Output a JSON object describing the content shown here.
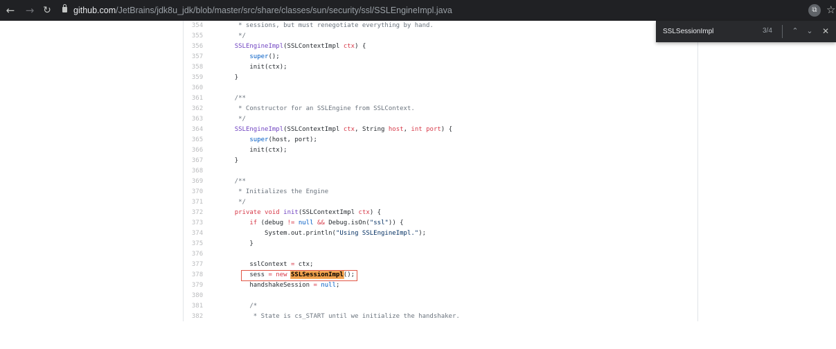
{
  "browser": {
    "url_domain": "github.com",
    "url_path": "/JetBrains/jdk8u_jdk/blob/master/src/share/classes/sun/security/ssl/SSLEngineImpl.java",
    "nav_icons": [
      "back-arrow-icon",
      "forward-arrow-icon",
      "reload-icon"
    ],
    "lock_icon": "lock-icon",
    "extension_icon_glyph": "⧉",
    "bookmark_icon_glyph": "☆"
  },
  "find_bar": {
    "query": "SSLSessionImpl",
    "count": "3/4",
    "icons": {
      "prev": "chevron-up-icon",
      "next": "chevron-down-icon",
      "close": "close-icon"
    }
  },
  "colors": {
    "toolbar_bg": "#202124",
    "keyword": "#d73a49",
    "entity": "#6f42c1",
    "constant": "#005cc5",
    "comment": "#6a737d",
    "search_highlight": "#f0a04b",
    "annotation_box": "#e15544"
  },
  "code": {
    "lines": [
      {
        "n": "354",
        "tokens": [
          {
            "t": "     * sessions, but must renegotiate everything by hand.",
            "c": "cmt"
          }
        ]
      },
      {
        "n": "355",
        "tokens": [
          {
            "t": "     */",
            "c": "cmt"
          }
        ]
      },
      {
        "n": "356",
        "tokens": [
          {
            "t": "    ",
            "c": ""
          },
          {
            "t": "SSLEngineImpl",
            "c": "ent"
          },
          {
            "t": "(SSLContextImpl ",
            "c": ""
          },
          {
            "t": "ctx",
            "c": "kw"
          },
          {
            "t": ") {",
            "c": ""
          }
        ]
      },
      {
        "n": "357",
        "tokens": [
          {
            "t": "        ",
            "c": ""
          },
          {
            "t": "super",
            "c": "sup"
          },
          {
            "t": "();",
            "c": ""
          }
        ]
      },
      {
        "n": "358",
        "tokens": [
          {
            "t": "        init(ctx);",
            "c": ""
          }
        ]
      },
      {
        "n": "359",
        "tokens": [
          {
            "t": "    }",
            "c": ""
          }
        ]
      },
      {
        "n": "360",
        "tokens": [
          {
            "t": "",
            "c": ""
          }
        ]
      },
      {
        "n": "361",
        "tokens": [
          {
            "t": "    /**",
            "c": "cmt"
          }
        ]
      },
      {
        "n": "362",
        "tokens": [
          {
            "t": "     * Constructor for an SSLEngine from SSLContext.",
            "c": "cmt"
          }
        ]
      },
      {
        "n": "363",
        "tokens": [
          {
            "t": "     */",
            "c": "cmt"
          }
        ]
      },
      {
        "n": "364",
        "tokens": [
          {
            "t": "    ",
            "c": ""
          },
          {
            "t": "SSLEngineImpl",
            "c": "ent"
          },
          {
            "t": "(SSLContextImpl ",
            "c": ""
          },
          {
            "t": "ctx",
            "c": "kw"
          },
          {
            "t": ", String ",
            "c": ""
          },
          {
            "t": "host",
            "c": "kw"
          },
          {
            "t": ", ",
            "c": ""
          },
          {
            "t": "int",
            "c": "kw"
          },
          {
            "t": " ",
            "c": ""
          },
          {
            "t": "port",
            "c": "kw"
          },
          {
            "t": ") {",
            "c": ""
          }
        ]
      },
      {
        "n": "365",
        "tokens": [
          {
            "t": "        ",
            "c": ""
          },
          {
            "t": "super",
            "c": "sup"
          },
          {
            "t": "(host, port);",
            "c": ""
          }
        ]
      },
      {
        "n": "366",
        "tokens": [
          {
            "t": "        init(ctx);",
            "c": ""
          }
        ]
      },
      {
        "n": "367",
        "tokens": [
          {
            "t": "    }",
            "c": ""
          }
        ]
      },
      {
        "n": "368",
        "tokens": [
          {
            "t": "",
            "c": ""
          }
        ]
      },
      {
        "n": "369",
        "tokens": [
          {
            "t": "    /**",
            "c": "cmt"
          }
        ]
      },
      {
        "n": "370",
        "tokens": [
          {
            "t": "     * Initializes the Engine",
            "c": "cmt"
          }
        ]
      },
      {
        "n": "371",
        "tokens": [
          {
            "t": "     */",
            "c": "cmt"
          }
        ]
      },
      {
        "n": "372",
        "tokens": [
          {
            "t": "    ",
            "c": ""
          },
          {
            "t": "private",
            "c": "kw"
          },
          {
            "t": " ",
            "c": ""
          },
          {
            "t": "void",
            "c": "kw"
          },
          {
            "t": " ",
            "c": ""
          },
          {
            "t": "init",
            "c": "ent"
          },
          {
            "t": "(SSLContextImpl ",
            "c": ""
          },
          {
            "t": "ctx",
            "c": "kw"
          },
          {
            "t": ") {",
            "c": ""
          }
        ]
      },
      {
        "n": "373",
        "tokens": [
          {
            "t": "        ",
            "c": ""
          },
          {
            "t": "if",
            "c": "kw"
          },
          {
            "t": " (debug ",
            "c": ""
          },
          {
            "t": "!=",
            "c": "kw"
          },
          {
            "t": " ",
            "c": ""
          },
          {
            "t": "null",
            "c": "sup"
          },
          {
            "t": " ",
            "c": ""
          },
          {
            "t": "&&",
            "c": "kw"
          },
          {
            "t": " Debug.isOn(",
            "c": ""
          },
          {
            "t": "\"ssl\"",
            "c": "str"
          },
          {
            "t": ")) {",
            "c": ""
          }
        ]
      },
      {
        "n": "374",
        "tokens": [
          {
            "t": "            System.out.println(",
            "c": ""
          },
          {
            "t": "\"Using SSLEngineImpl.\"",
            "c": "str"
          },
          {
            "t": ");",
            "c": ""
          }
        ]
      },
      {
        "n": "375",
        "tokens": [
          {
            "t": "        }",
            "c": ""
          }
        ]
      },
      {
        "n": "376",
        "tokens": [
          {
            "t": "",
            "c": ""
          }
        ]
      },
      {
        "n": "377",
        "tokens": [
          {
            "t": "        sslContext ",
            "c": ""
          },
          {
            "t": "=",
            "c": "kw"
          },
          {
            "t": " ctx;",
            "c": ""
          }
        ]
      },
      {
        "n": "378",
        "tokens": [
          {
            "t": "        sess ",
            "c": ""
          },
          {
            "t": "=",
            "c": "kw"
          },
          {
            "t": " ",
            "c": ""
          },
          {
            "t": "new",
            "c": "kw"
          },
          {
            "t": " ",
            "c": ""
          },
          {
            "t": "SSLSessionImpl",
            "c": "hit"
          },
          {
            "t": "();",
            "c": ""
          }
        ]
      },
      {
        "n": "379",
        "tokens": [
          {
            "t": "        handshakeSession ",
            "c": ""
          },
          {
            "t": "=",
            "c": "kw"
          },
          {
            "t": " ",
            "c": ""
          },
          {
            "t": "null",
            "c": "sup"
          },
          {
            "t": ";",
            "c": ""
          }
        ]
      },
      {
        "n": "380",
        "tokens": [
          {
            "t": "",
            "c": ""
          }
        ]
      },
      {
        "n": "381",
        "tokens": [
          {
            "t": "        /*",
            "c": "cmt"
          }
        ]
      },
      {
        "n": "382",
        "tokens": [
          {
            "t": "         * State is cs_START until we initialize the handshaker.",
            "c": "cmt"
          }
        ]
      }
    ]
  }
}
